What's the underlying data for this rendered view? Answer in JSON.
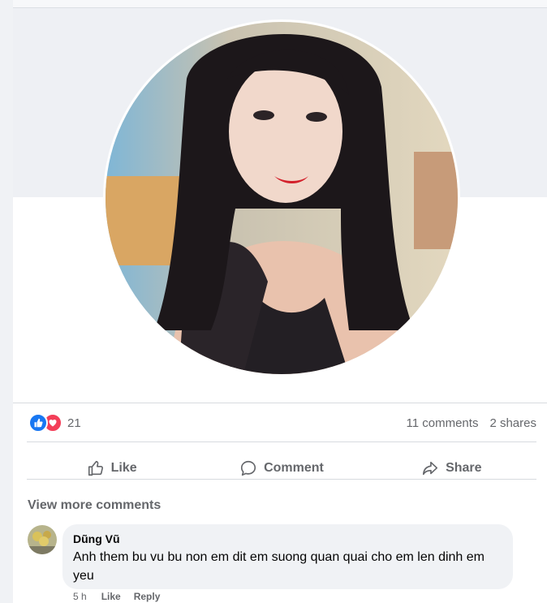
{
  "post": {
    "reactions": {
      "count": "21",
      "icons": [
        "like-icon",
        "love-icon"
      ]
    },
    "stats": {
      "comments": "11 comments",
      "shares": "2 shares"
    },
    "actions": [
      {
        "label": "Like",
        "icon": "thumbs-up-icon"
      },
      {
        "label": "Comment",
        "icon": "comment-icon"
      },
      {
        "label": "Share",
        "icon": "share-icon"
      }
    ],
    "view_more_comments": "View more comments"
  },
  "comments": [
    {
      "author": "Dũng Vũ",
      "text": "Anh them bu vu bu non em dit em suong quan quai cho em len dinh em yeu",
      "time": "5 h",
      "like_label": "Like",
      "reply_label": "Reply"
    }
  ],
  "colors": {
    "like_blue": "#1877f2",
    "love_red": "#f33e58",
    "secondary_text": "#65676b",
    "bubble": "#f0f2f5"
  }
}
